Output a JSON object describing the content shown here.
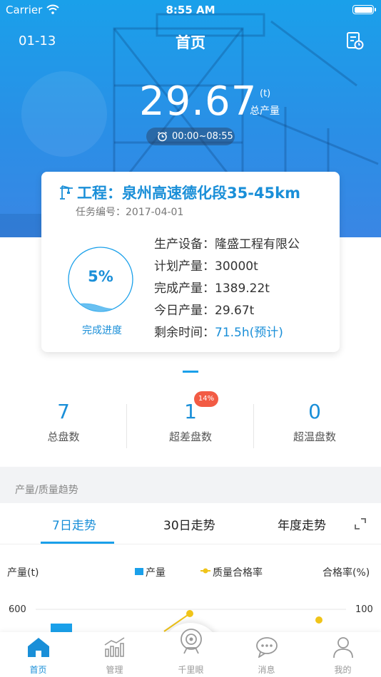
{
  "status_bar": {
    "carrier": "Carrier",
    "time": "8:55 AM"
  },
  "nav": {
    "date": "01-13",
    "title": "首页"
  },
  "summary": {
    "total_output": "29.67",
    "unit": "(t)",
    "total_label": "总产量",
    "time_range": "00:00~08:55"
  },
  "project": {
    "title": "工程：泉州高速德化段35-45km",
    "task_no": "任务编号：2017-04-01",
    "progress_percent": 5,
    "progress_text": "5%",
    "progress_label": "完成进度",
    "info": [
      {
        "label": "生产设备：",
        "value": "隆盛工程有限公"
      },
      {
        "label": "计划产量：",
        "value": "30000t"
      },
      {
        "label": "完成产量：",
        "value": "1389.22t"
      },
      {
        "label": "今日产量：",
        "value": "29.67t"
      },
      {
        "label": "剩余时间：",
        "value": "71.5h(预计)"
      }
    ]
  },
  "stats": [
    {
      "value": "7",
      "label": "总盘数"
    },
    {
      "value": "1",
      "label": "超差盘数",
      "badge": "14%"
    },
    {
      "value": "0",
      "label": "超温盘数"
    }
  ],
  "section_title": "产量/质量趋势",
  "trend_tabs": [
    {
      "label": "7日走势",
      "active": true
    },
    {
      "label": "30日走势",
      "active": false
    },
    {
      "label": "年度走势",
      "active": false
    }
  ],
  "chart_labels": {
    "ylabel_left": "产量(t)",
    "ylabel_right": "合格率(%)",
    "legend_production": "产量",
    "legend_quality": "质量合格率",
    "tick_left_top": "600",
    "tick_right_top": "100"
  },
  "chart_data": {
    "type": "bar",
    "series": [
      {
        "name": "产量",
        "type": "bar",
        "axis": "left",
        "values": [
          560
        ]
      },
      {
        "name": "质量合格率",
        "type": "line",
        "axis": "right",
        "values": [
          96,
          98,
          95
        ]
      }
    ],
    "ylabel": "产量(t)",
    "y2label": "合格率(%)",
    "ylim": [
      0,
      600
    ],
    "y2lim": [
      0,
      100
    ],
    "grid": true,
    "legend": "top-center"
  },
  "tab_bar": [
    {
      "label": "首页",
      "icon": "home-icon",
      "active": true
    },
    {
      "label": "管理",
      "icon": "chart-icon",
      "active": false
    },
    {
      "label": "千里眼",
      "icon": "camera-icon",
      "active": false
    },
    {
      "label": "消息",
      "icon": "message-icon",
      "active": false
    },
    {
      "label": "我的",
      "icon": "user-icon",
      "active": false
    }
  ],
  "colors": {
    "primary": "#1aa0ea",
    "accent_text": "#1a8fd8",
    "badge": "#f25b44",
    "quality_line": "#f0c419"
  }
}
